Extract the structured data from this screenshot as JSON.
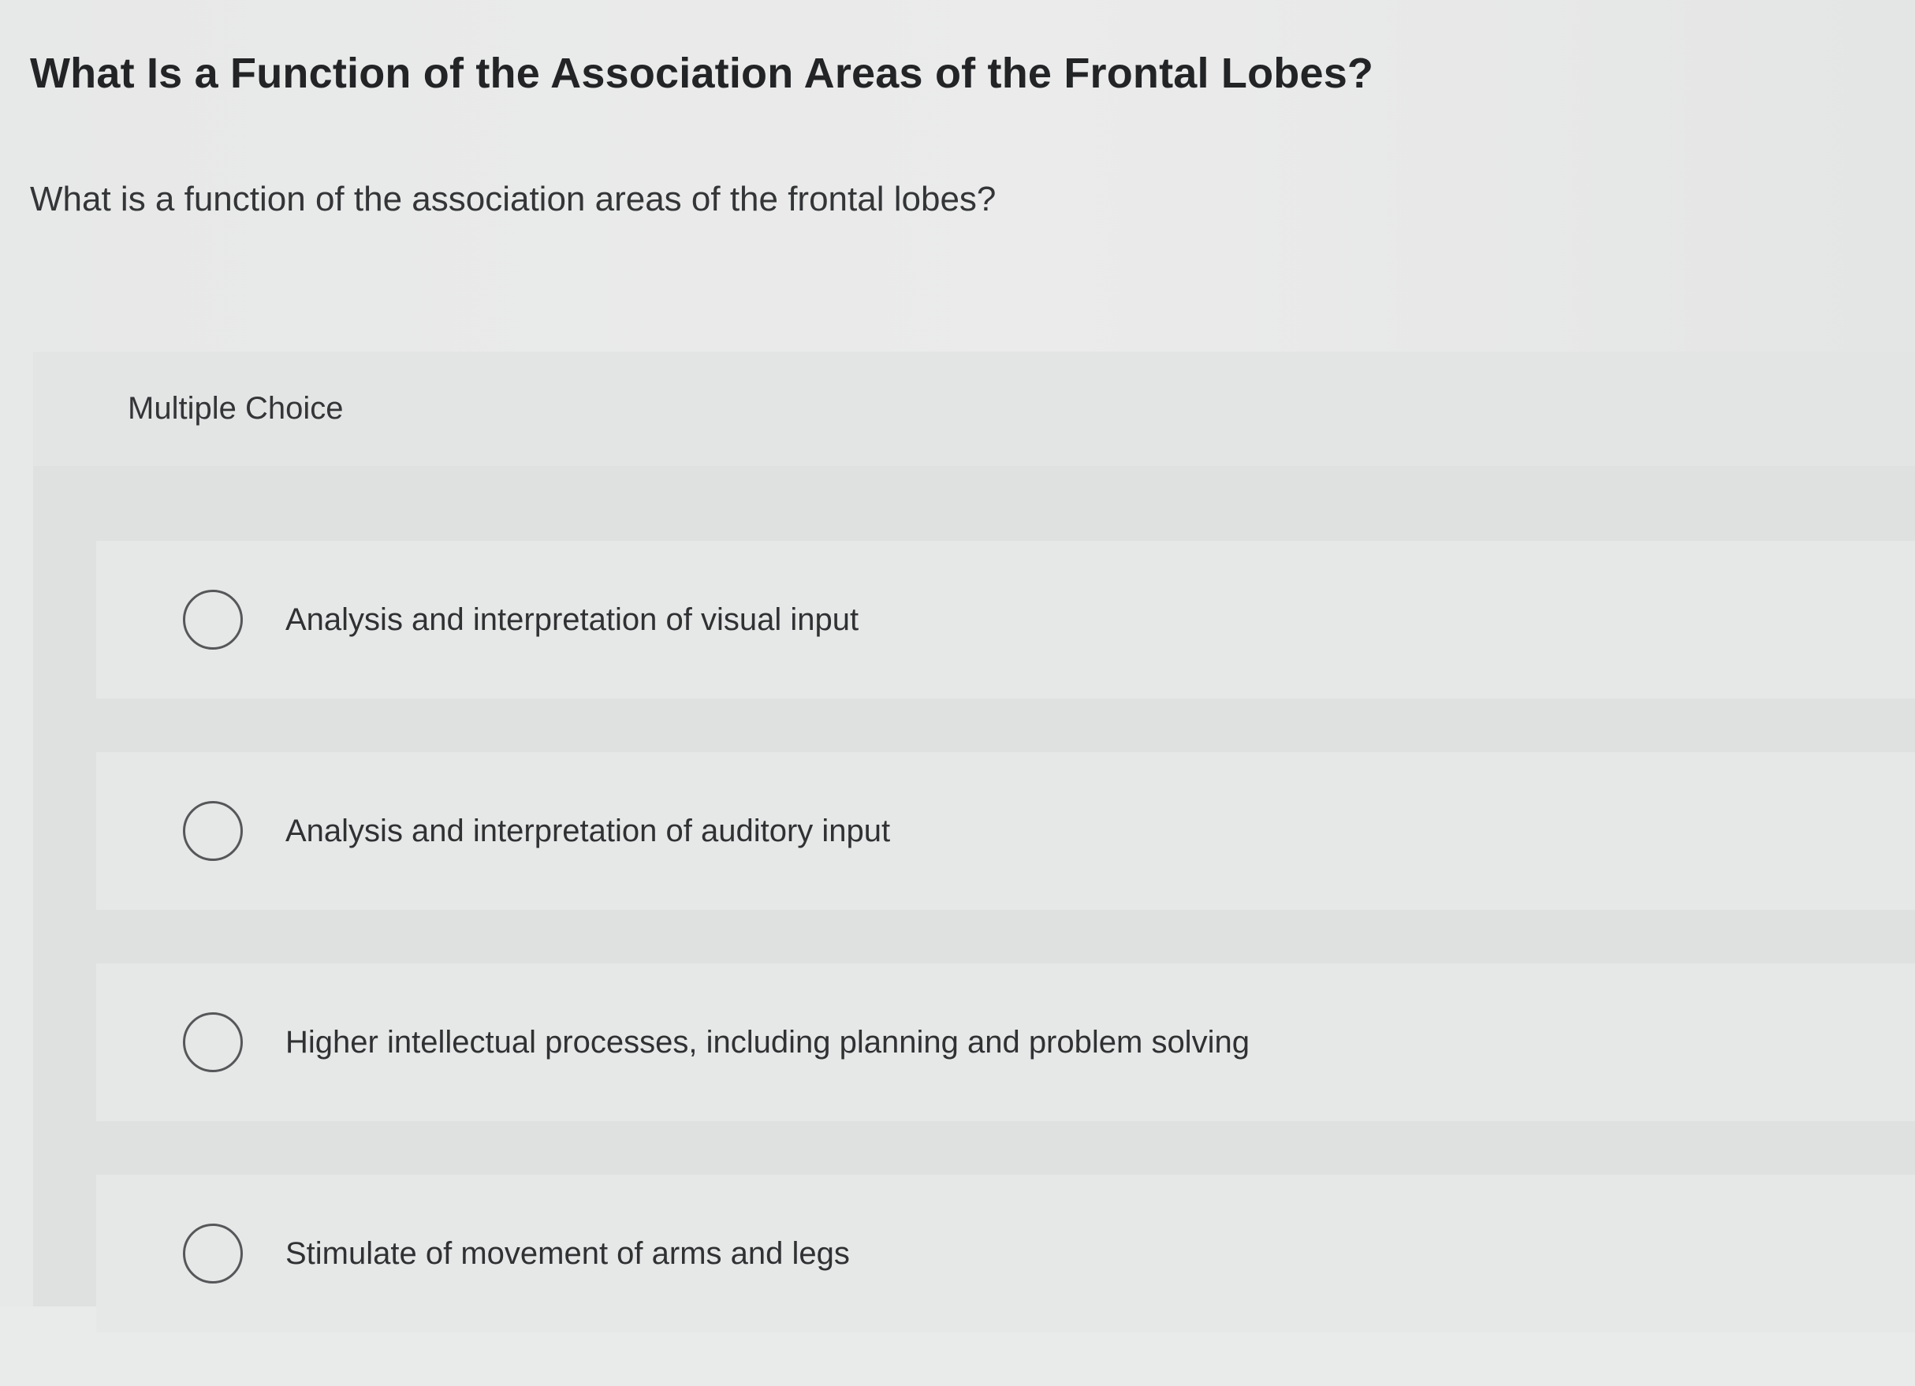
{
  "header": {
    "title": "What Is a Function of the Association Areas of the Frontal Lobes?"
  },
  "question": {
    "text": "What is a function of the association areas of the frontal lobes?"
  },
  "multiple_choice": {
    "label": "Multiple Choice",
    "options": [
      {
        "label": "Analysis and interpretation of visual input"
      },
      {
        "label": "Analysis and interpretation of auditory input"
      },
      {
        "label": "Higher intellectual processes, including planning and problem solving"
      },
      {
        "label": "Stimulate of movement of arms and legs"
      }
    ]
  },
  "colors": {
    "background": "#e9eaea",
    "panel": "#dfe0e0",
    "option_card": "#e6e7e7",
    "text": "#2b2d2f",
    "radio_border": "#555759"
  }
}
